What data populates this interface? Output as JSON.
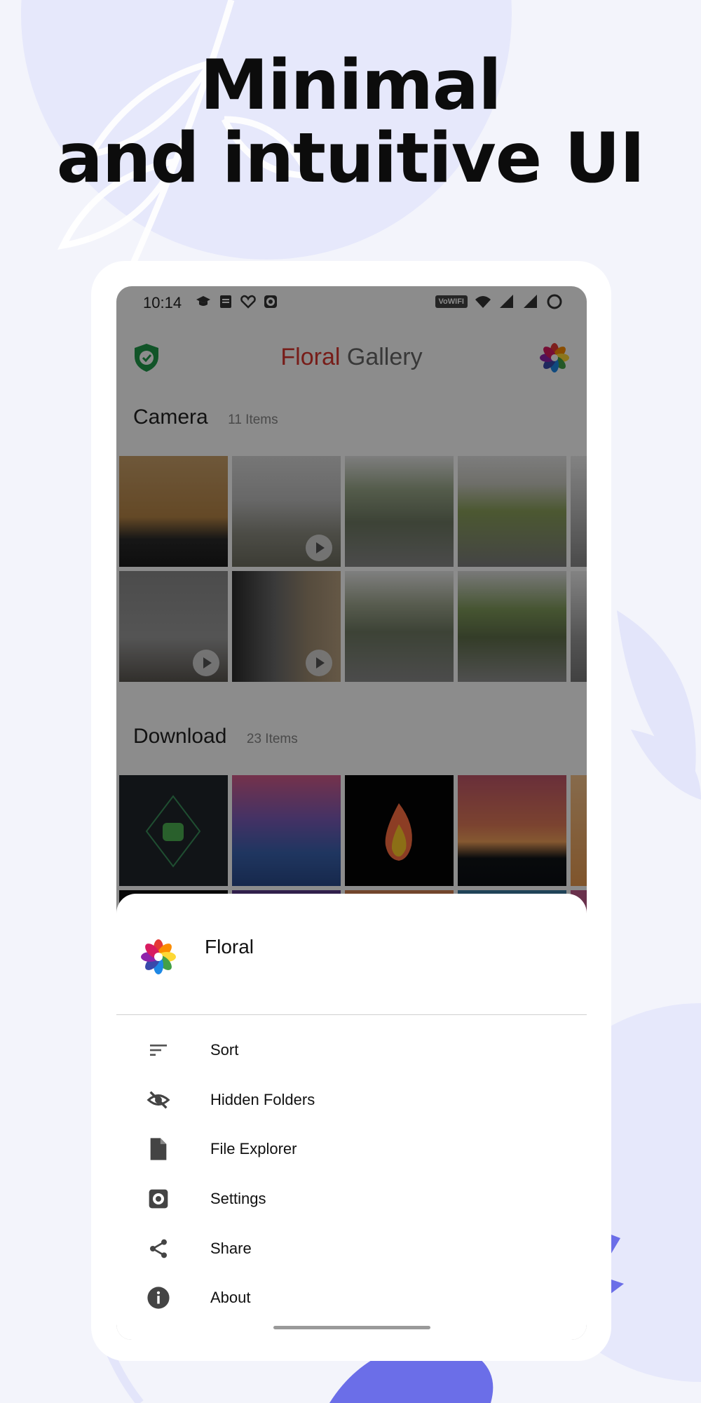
{
  "headline": {
    "line1": "Minimal",
    "line2": "and intuitive UI"
  },
  "statusbar": {
    "time": "10:14",
    "wifi_badge": "VoWIFI"
  },
  "app": {
    "title_part1": "Floral",
    "title_part2": " Gallery"
  },
  "sections": [
    {
      "name": "Camera",
      "count": "11 Items"
    },
    {
      "name": "Download",
      "count": "23 Items"
    }
  ],
  "sheet": {
    "title": "Floral",
    "items": [
      {
        "label": "Sort",
        "icon": "sort-icon"
      },
      {
        "label": "Hidden Folders",
        "icon": "eye-off-icon"
      },
      {
        "label": "File Explorer",
        "icon": "file-icon"
      },
      {
        "label": "Settings",
        "icon": "gear-icon"
      },
      {
        "label": "Share",
        "icon": "share-icon"
      },
      {
        "label": "About",
        "icon": "info-icon"
      }
    ]
  },
  "colors": {
    "background": "#f3f4fb",
    "accent_red": "#d9362e",
    "decor_blue": "#6b6ee8"
  }
}
